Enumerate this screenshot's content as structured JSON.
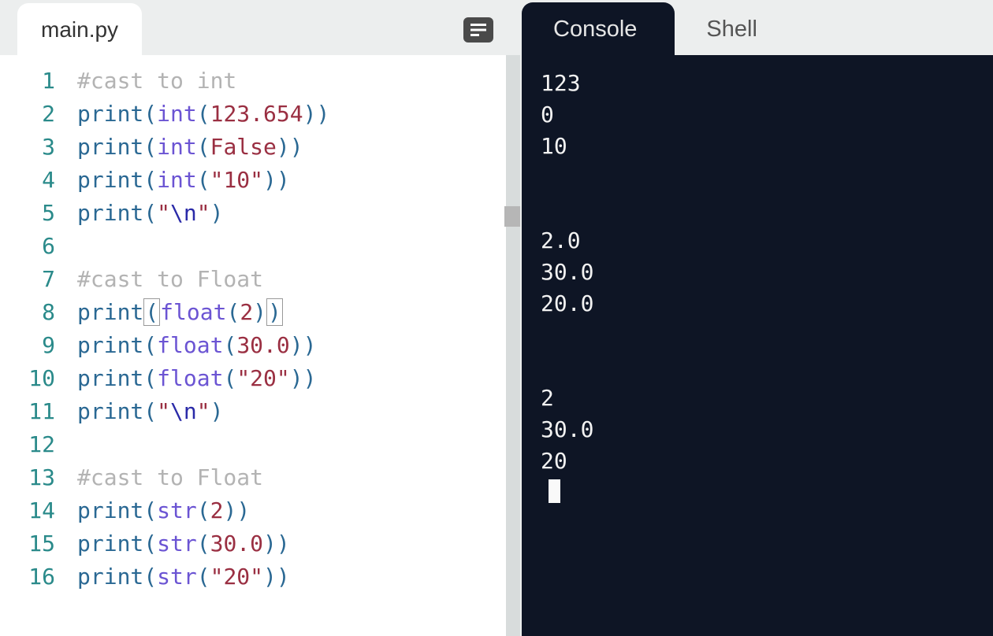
{
  "editor": {
    "tab_label": "main.py",
    "gutter": [
      "1",
      "2",
      "3",
      "4",
      "5",
      "6",
      "7",
      "8",
      "9",
      "10",
      "11",
      "12",
      "13",
      "14",
      "15",
      "16"
    ],
    "lines": [
      [
        {
          "cls": "c-comment",
          "t": "#cast to int"
        }
      ],
      [
        {
          "cls": "c-builtin",
          "t": "print"
        },
        {
          "cls": "c-punc",
          "t": "("
        },
        {
          "cls": "c-func",
          "t": "int"
        },
        {
          "cls": "c-punc",
          "t": "("
        },
        {
          "cls": "c-num",
          "t": "123.654"
        },
        {
          "cls": "c-punc",
          "t": ")"
        },
        {
          "cls": "c-punc",
          "t": ")"
        }
      ],
      [
        {
          "cls": "c-builtin",
          "t": "print"
        },
        {
          "cls": "c-punc",
          "t": "("
        },
        {
          "cls": "c-func",
          "t": "int"
        },
        {
          "cls": "c-punc",
          "t": "("
        },
        {
          "cls": "c-bool",
          "t": "False"
        },
        {
          "cls": "c-punc",
          "t": ")"
        },
        {
          "cls": "c-punc",
          "t": ")"
        }
      ],
      [
        {
          "cls": "c-builtin",
          "t": "print"
        },
        {
          "cls": "c-punc",
          "t": "("
        },
        {
          "cls": "c-func",
          "t": "int"
        },
        {
          "cls": "c-punc",
          "t": "("
        },
        {
          "cls": "c-str",
          "t": "\"10\""
        },
        {
          "cls": "c-punc",
          "t": ")"
        },
        {
          "cls": "c-punc",
          "t": ")"
        }
      ],
      [
        {
          "cls": "c-builtin",
          "t": "print"
        },
        {
          "cls": "c-punc",
          "t": "("
        },
        {
          "cls": "c-str",
          "t": "\""
        },
        {
          "cls": "c-esc",
          "t": "\\n"
        },
        {
          "cls": "c-str",
          "t": "\""
        },
        {
          "cls": "c-punc",
          "t": ")"
        }
      ],
      [],
      [
        {
          "cls": "c-comment",
          "t": "#cast to Float"
        }
      ],
      [
        {
          "cls": "c-builtin",
          "t": "print"
        },
        {
          "cls": "c-punc bracket-match",
          "t": "("
        },
        {
          "cls": "c-func",
          "t": "float"
        },
        {
          "cls": "c-punc",
          "t": "("
        },
        {
          "cls": "c-num",
          "t": "2"
        },
        {
          "cls": "c-punc",
          "t": ")"
        },
        {
          "cls": "c-punc bracket-match",
          "t": ")"
        }
      ],
      [
        {
          "cls": "c-builtin",
          "t": "print"
        },
        {
          "cls": "c-punc",
          "t": "("
        },
        {
          "cls": "c-func",
          "t": "float"
        },
        {
          "cls": "c-punc",
          "t": "("
        },
        {
          "cls": "c-num",
          "t": "30.0"
        },
        {
          "cls": "c-punc",
          "t": ")"
        },
        {
          "cls": "c-punc",
          "t": ")"
        }
      ],
      [
        {
          "cls": "c-builtin",
          "t": "print"
        },
        {
          "cls": "c-punc",
          "t": "("
        },
        {
          "cls": "c-func",
          "t": "float"
        },
        {
          "cls": "c-punc",
          "t": "("
        },
        {
          "cls": "c-str",
          "t": "\"20\""
        },
        {
          "cls": "c-punc",
          "t": ")"
        },
        {
          "cls": "c-punc",
          "t": ")"
        }
      ],
      [
        {
          "cls": "c-builtin",
          "t": "print"
        },
        {
          "cls": "c-punc",
          "t": "("
        },
        {
          "cls": "c-str",
          "t": "\""
        },
        {
          "cls": "c-esc",
          "t": "\\n"
        },
        {
          "cls": "c-str",
          "t": "\""
        },
        {
          "cls": "c-punc",
          "t": ")"
        }
      ],
      [],
      [
        {
          "cls": "c-comment",
          "t": "#cast to Float"
        }
      ],
      [
        {
          "cls": "c-builtin",
          "t": "print"
        },
        {
          "cls": "c-punc",
          "t": "("
        },
        {
          "cls": "c-func",
          "t": "str"
        },
        {
          "cls": "c-punc",
          "t": "("
        },
        {
          "cls": "c-num",
          "t": "2"
        },
        {
          "cls": "c-punc",
          "t": ")"
        },
        {
          "cls": "c-punc",
          "t": ")"
        }
      ],
      [
        {
          "cls": "c-builtin",
          "t": "print"
        },
        {
          "cls": "c-punc",
          "t": "("
        },
        {
          "cls": "c-func",
          "t": "str"
        },
        {
          "cls": "c-punc",
          "t": "("
        },
        {
          "cls": "c-num",
          "t": "30.0"
        },
        {
          "cls": "c-punc",
          "t": ")"
        },
        {
          "cls": "c-punc",
          "t": ")"
        }
      ],
      [
        {
          "cls": "c-builtin",
          "t": "print"
        },
        {
          "cls": "c-punc",
          "t": "("
        },
        {
          "cls": "c-func",
          "t": "str"
        },
        {
          "cls": "c-punc",
          "t": "("
        },
        {
          "cls": "c-str",
          "t": "\"20\""
        },
        {
          "cls": "c-punc",
          "t": ")"
        },
        {
          "cls": "c-punc",
          "t": ")"
        }
      ]
    ]
  },
  "console": {
    "tab_console": "Console",
    "tab_shell": "Shell",
    "output": "123\n0\n10\n\n\n2.0\n30.0\n20.0\n\n\n2\n30.0\n20",
    "prompt": ""
  }
}
